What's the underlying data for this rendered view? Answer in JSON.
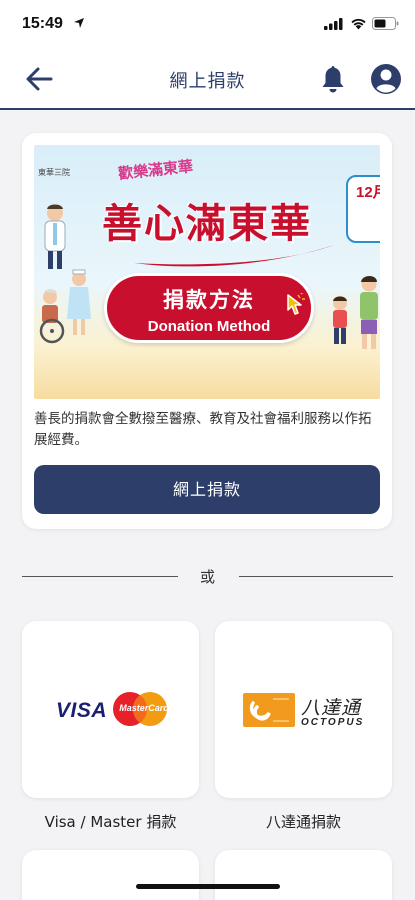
{
  "status_bar": {
    "time": "15:49"
  },
  "header": {
    "title": "網上捐款"
  },
  "banner": {
    "top_title": "歡樂滿東華",
    "org": "東華三院",
    "main_title": "善心滿東華",
    "pill_zh": "捐款方法",
    "pill_en": "Donation Method",
    "date": "12月"
  },
  "card": {
    "description": "善長的捐款會全數撥至醫療、教育及社會福利服務以作拓展經費。",
    "button_label": "網上捐款"
  },
  "divider": {
    "text": "或"
  },
  "payment_options": [
    {
      "label": "Visa / Master 捐款",
      "logo_visa": "VISA",
      "logo_mc": "MasterCard"
    },
    {
      "label": "八達通捐款",
      "logo_zh": "八達通",
      "logo_en": "OCTOPUS"
    }
  ],
  "colors": {
    "primary": "#2d3e6b",
    "banner_red": "#c8102e",
    "background": "#f3f3f5"
  },
  "icons": [
    "back-arrow-icon",
    "bell-icon",
    "account-icon",
    "location-arrow-icon",
    "signal-icon",
    "wifi-icon",
    "battery-icon",
    "pointer-hand-icon"
  ]
}
